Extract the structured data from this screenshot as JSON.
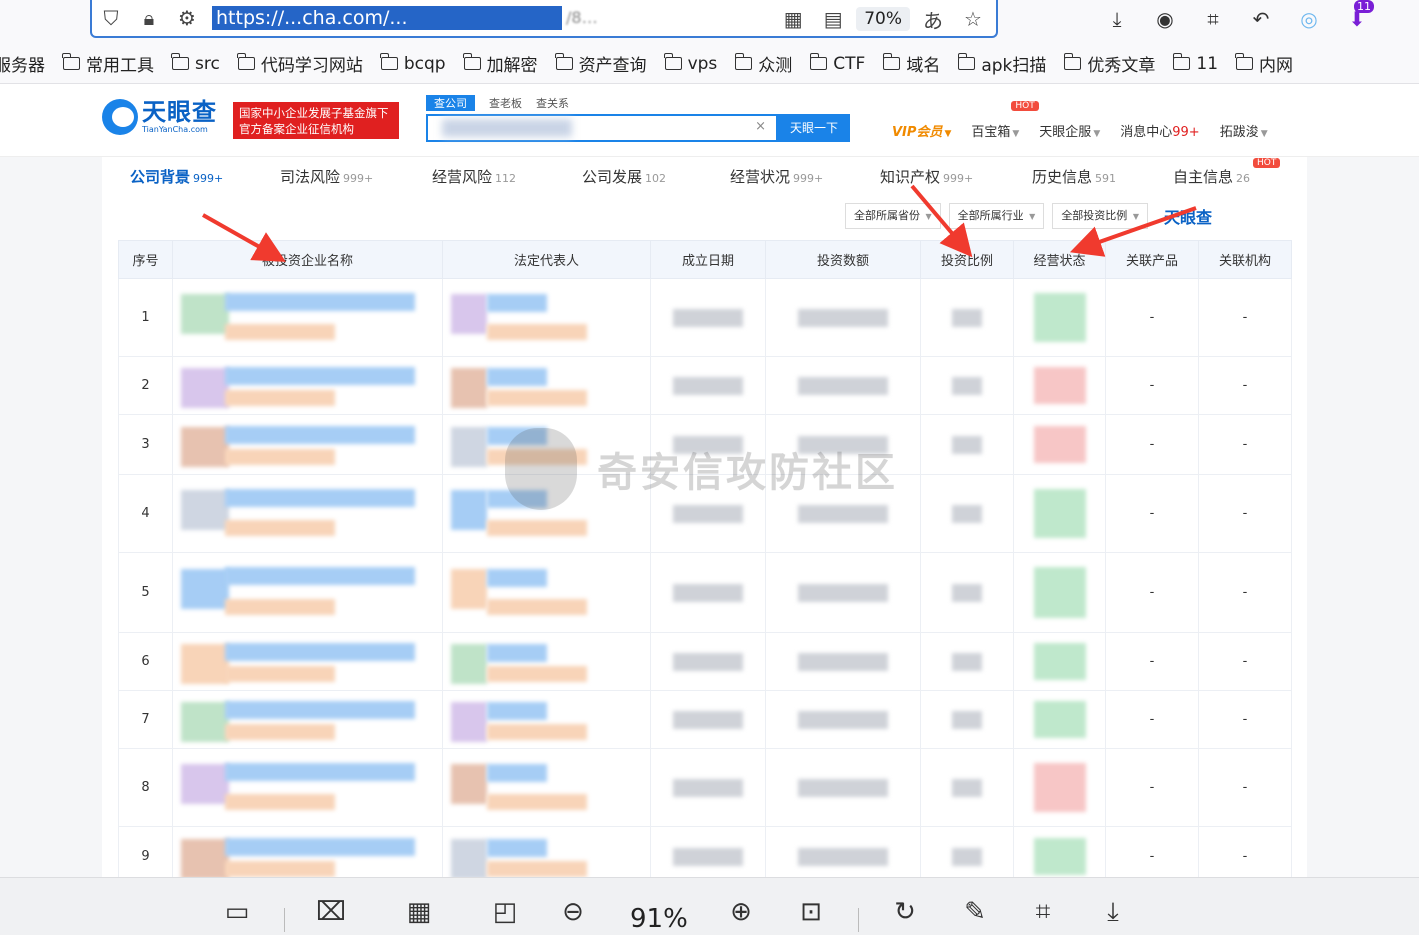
{
  "browser": {
    "url_visible": "https://...cha.com/...",
    "zoom": "70%",
    "bookmarks": [
      "服务器",
      "常用工具",
      "src",
      "代码学习网站",
      "bcqp",
      "加解密",
      "资产查询",
      "vps",
      "众测",
      "CTF",
      "域名",
      "apk扫描",
      "优秀文章",
      "11",
      "内网"
    ],
    "extension_badge": "11"
  },
  "site": {
    "logo_cn": "天眼查",
    "logo_en": "TianYanCha.com",
    "tag_line1": "国家中小企业发展子基金旗下",
    "tag_line2": "官方备案企业征信机构",
    "search_tabs": [
      "查公司",
      "查老板",
      "查关系"
    ],
    "search_clear": "×",
    "search_button": "天眼一下",
    "nav": {
      "vip": "VIP会员",
      "baibao": "百宝箱",
      "hot": "HOT",
      "qifu": "天眼企服",
      "msg": "消息中心",
      "msg_count": "99+",
      "user": "拓跋浚"
    }
  },
  "tabs": [
    {
      "label": "公司背景",
      "count": "999+"
    },
    {
      "label": "司法风险",
      "count": "999+"
    },
    {
      "label": "经营风险",
      "count": "112"
    },
    {
      "label": "公司发展",
      "count": "102"
    },
    {
      "label": "经营状况",
      "count": "999+"
    },
    {
      "label": "知识产权",
      "count": "999+"
    },
    {
      "label": "历史信息",
      "count": "591"
    },
    {
      "label": "自主信息",
      "count": "26"
    }
  ],
  "filters": [
    "全部所属省份",
    "全部所属行业",
    "全部投资比例"
  ],
  "mini_logo": "天眼查",
  "table": {
    "headers": [
      "序号",
      "被投资企业名称",
      "法定代表人",
      "成立日期",
      "投资数额",
      "投资比例",
      "经营状态",
      "关联产品",
      "关联机构"
    ],
    "rows": [
      {
        "idx": "1",
        "product": "-",
        "org": "-"
      },
      {
        "idx": "2",
        "product": "-",
        "org": "-"
      },
      {
        "idx": "3",
        "product": "-",
        "org": "-"
      },
      {
        "idx": "4",
        "product": "-",
        "org": "-"
      },
      {
        "idx": "5",
        "product": "-",
        "org": "-"
      },
      {
        "idx": "6",
        "product": "-",
        "org": "-"
      },
      {
        "idx": "7",
        "product": "-",
        "org": "-"
      },
      {
        "idx": "8",
        "product": "-",
        "org": "-"
      },
      {
        "idx": "9",
        "product": "-",
        "org": "-"
      }
    ]
  },
  "watermark": "奇安信攻防社区",
  "viewer": {
    "zoom": "91%"
  },
  "colors": {
    "brand": "#1a83e8",
    "brand_dark": "#0a62c5",
    "red": "#e02020",
    "vip": "#f08a00",
    "arrow": "#f03a2e"
  }
}
